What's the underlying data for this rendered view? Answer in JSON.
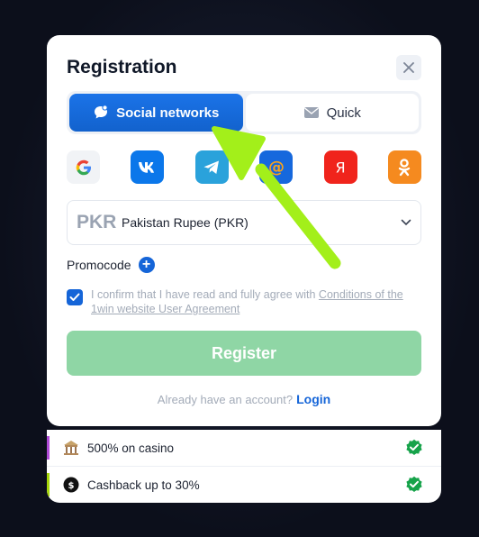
{
  "modal": {
    "title": "Registration",
    "tabs": [
      {
        "label": "Social networks",
        "icon": "chat-bubble-icon",
        "active": true
      },
      {
        "label": "Quick",
        "icon": "envelope-icon",
        "active": false
      }
    ],
    "social_providers": [
      {
        "name": "google",
        "glyph": "G",
        "color": "#f1f3f6"
      },
      {
        "name": "vk",
        "glyph": "VK",
        "color": "#0b77ea"
      },
      {
        "name": "telegram",
        "glyph": "",
        "color": "#2aa2db"
      },
      {
        "name": "mail-ru",
        "glyph": "@",
        "color": "#1668dd"
      },
      {
        "name": "yandex",
        "glyph": "Я",
        "color": "#f0241c"
      },
      {
        "name": "odnoklassniki",
        "glyph": "",
        "color": "#f58a1f"
      }
    ],
    "currency": {
      "code": "PKR",
      "name": "Pakistan Rupee (PKR)"
    },
    "promocode_label": "Promocode",
    "agreement": {
      "text": "I confirm that I have read and fully agree with ",
      "link": "Conditions of the 1win website User Agreement",
      "checked": true
    },
    "register_label": "Register",
    "login_prompt": "Already have an account?",
    "login_link": "Login"
  },
  "bonuses": [
    {
      "label": "500% on casino",
      "icon": "casino-icon",
      "stripe": "#b04bd8"
    },
    {
      "label": "Cashback up to 30%",
      "icon": "cashback-icon",
      "stripe": "#a6d60a"
    }
  ],
  "colors": {
    "accent": "#1565d8",
    "register_disabled": "#8fd6a5",
    "badge_green": "#16a34a",
    "arrow": "#a3ef1a"
  }
}
